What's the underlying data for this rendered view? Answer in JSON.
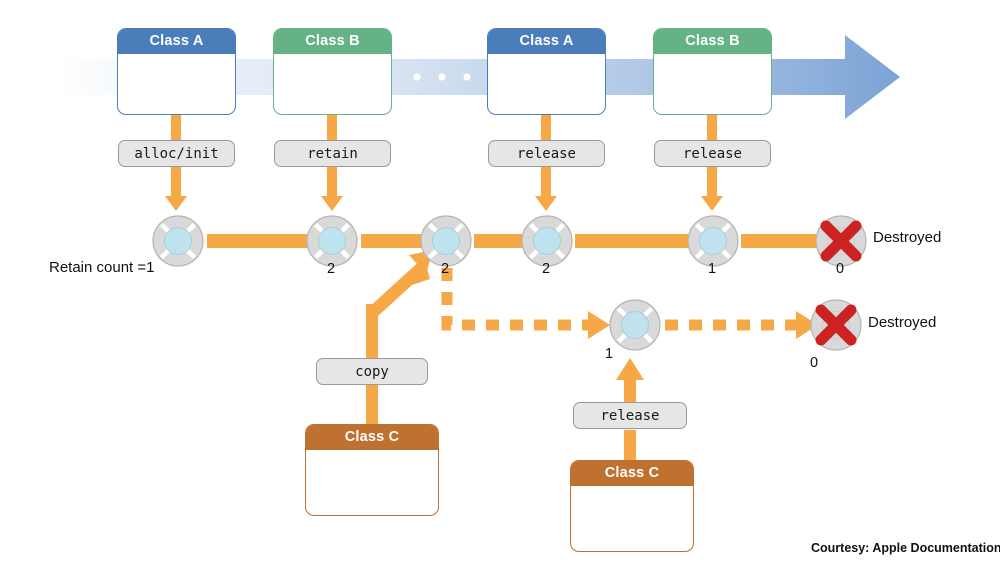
{
  "diagram": {
    "title": "Objective-C reference counting lifecycle",
    "colors": {
      "class_a": "#4a7ebb",
      "class_b": "#64b285",
      "class_c": "#bf7130",
      "arrow": "#f5a845",
      "band": "#7ba3d6",
      "object_ring": "#d9d9d9",
      "object_core": "#bfe2ef",
      "destroyed_x": "#cc2222",
      "pill_bg": "#e6e6e6"
    },
    "timeline_boxes": [
      {
        "label": "Class A",
        "style": "blue"
      },
      {
        "label": "Class B",
        "style": "green"
      },
      {
        "label": "Class A",
        "style": "blue"
      },
      {
        "label": "Class B",
        "style": "green"
      }
    ],
    "timeline_ellipsis": "•  •  •",
    "messages": [
      {
        "label": "alloc/init"
      },
      {
        "label": "retain"
      },
      {
        "label": "release"
      },
      {
        "label": "release"
      },
      {
        "label": "copy"
      },
      {
        "label": "release"
      }
    ],
    "main_chain": {
      "retain_count_label": "Retain count =1",
      "counts": [
        "2",
        "2",
        "2",
        "1",
        "0"
      ],
      "destroyed_label": "Destroyed"
    },
    "copy_chain": {
      "counts": [
        "1",
        "0"
      ],
      "destroyed_label": "Destroyed",
      "class_boxes": [
        {
          "label": "Class C",
          "style": "brown"
        },
        {
          "label": "Class C",
          "style": "brown"
        }
      ]
    },
    "credit": "Courtesy: Apple Documentation"
  }
}
